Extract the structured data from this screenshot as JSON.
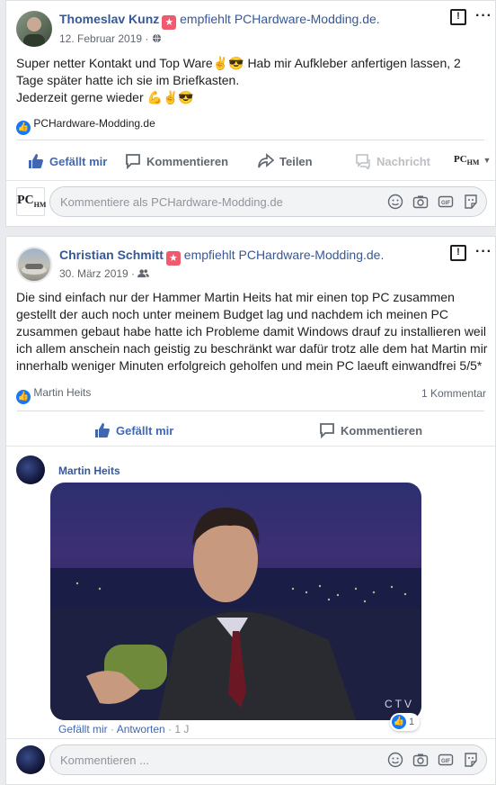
{
  "post1": {
    "author": "Thomeslav Kunz",
    "recommends": "empfiehlt",
    "page": "PCHardware-Modding.de.",
    "date": "12. Februar 2019 ·",
    "text_line1": "Super netter Kontakt und Top Ware✌️😎 Hab mir Aufkleber anfertigen lassen, 2",
    "text_line2": "Tage später hatte ich sie im Briefkasten.",
    "text_line3": "Jederzeit gerne wieder 💪✌️😎",
    "likes_name": "PCHardware-Modding.de",
    "actions": {
      "like": "Gefällt mir",
      "comment": "Kommentieren",
      "share": "Teilen",
      "message": "Nachricht"
    },
    "comment_placeholder": "Kommentiere als PCHardware-Modding.de"
  },
  "post2": {
    "author": "Christian Schmitt",
    "recommends": "empfiehlt",
    "page": "PCHardware-Modding.de.",
    "date": "30. März 2019 ·",
    "text": "Die sind einfach nur der Hammer Martin Heits hat mir einen top PC zusammen gestellt der auch noch unter meinem Budget lag und nachdem ich meinen PC zusammen gebaut habe hatte ich Probleme damit Windows drauf zu installieren weil ich allem anschein nach geistig zu beschränkt war dafür trotz alle dem hat Martin mir innerhalb weniger Minuten erfolgreich geholfen und mein PC laeuft einwandfrei 5/5*",
    "likes_name": "Martin Heits",
    "comment_count": "1 Kommentar",
    "actions": {
      "like": "Gefällt mir",
      "comment": "Kommentieren"
    },
    "comment": {
      "author": "Martin Heits",
      "gif_watermark": "CTV",
      "like_link": "Gefällt mir",
      "reply_link": "Antworten",
      "age": "· 1 J",
      "reaction_count": "1"
    },
    "comment_placeholder": "Kommentieren ..."
  },
  "icons": {
    "like": "thumbs-up-icon",
    "comment": "speech-bubble-icon",
    "share": "share-arrow-icon",
    "message": "messenger-icon",
    "globe": "globe-icon",
    "friends": "friends-icon",
    "emoji": "smiley-icon",
    "camera": "camera-icon",
    "gif": "gif-icon",
    "sticker": "sticker-icon"
  },
  "colors": {
    "link": "#365899",
    "accent": "#4267b2",
    "star": "#f1596e"
  }
}
